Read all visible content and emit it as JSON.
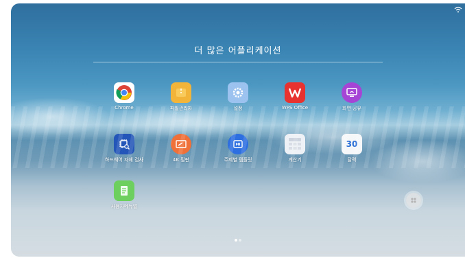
{
  "header": {
    "title": "더 많은 어플리케이션"
  },
  "apps": [
    {
      "label": "Chrome"
    },
    {
      "label": "파일관리자"
    },
    {
      "label": "설정"
    },
    {
      "label": "WPS Office"
    },
    {
      "label": "화면 공유"
    },
    {
      "label": "하드웨어 자체 검사"
    },
    {
      "label": "4K 필판"
    },
    {
      "label": "주제별 템플릿"
    },
    {
      "label": "계산기"
    },
    {
      "label": "달력",
      "badge": "30"
    },
    {
      "label": "사용자메뉴얼"
    }
  ],
  "icons": {
    "chrome": "chrome-icon",
    "files": "folder-icon",
    "settings": "gear-icon",
    "wps": "wps-office-icon",
    "share": "screen-share-icon",
    "hwcheck": "chip-scan-icon",
    "whiteboard": "whiteboard-icon",
    "template": "template-icon",
    "calculator": "calculator-icon",
    "calendar": "calendar-icon",
    "manual": "document-icon"
  },
  "pagination": {
    "pages": 2,
    "current": 1
  }
}
